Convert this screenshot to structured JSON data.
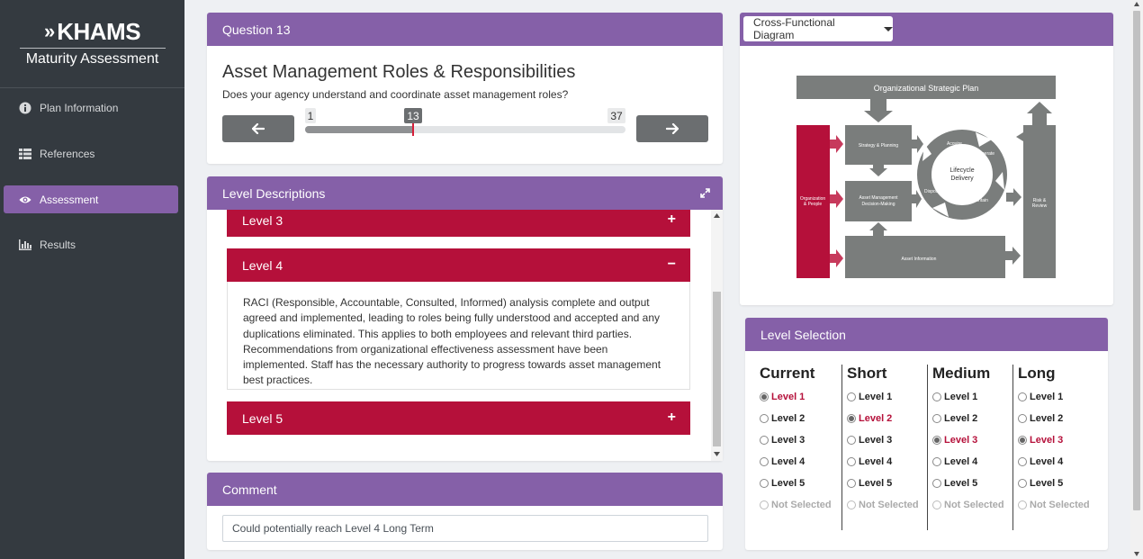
{
  "brand": {
    "logo_main": "KHAMS",
    "logo_sub": "Maturity Assessment"
  },
  "nav": [
    {
      "label": "Plan Information",
      "icon": "info-icon"
    },
    {
      "label": "References",
      "icon": "table-icon"
    },
    {
      "label": "Assessment",
      "icon": "eye-icon"
    },
    {
      "label": "Results",
      "icon": "bar-chart-icon"
    }
  ],
  "question": {
    "header": "Question 13",
    "title": "Asset Management Roles & Responsibilities",
    "subtitle": "Does your agency understand and coordinate asset management roles?",
    "slider": {
      "min": "1",
      "current": "13",
      "max": "37"
    }
  },
  "levels": {
    "header": "Level Descriptions",
    "items": [
      {
        "label": "Level 3",
        "state": "+"
      },
      {
        "label": "Level 4",
        "state": "−",
        "body": "RACI (Responsible, Accountable, Consulted, Informed) analysis complete and output agreed and implemented, leading to roles being fully understood and accepted and any duplications eliminated. This applies to both employees and relevant third parties. Recommendations from organizational effectiveness assessment have been implemented. Staff has the necessary authority to progress towards asset management best practices."
      },
      {
        "label": "Level 5",
        "state": "+"
      }
    ]
  },
  "comment": {
    "header": "Comment",
    "value": "Could potentially reach Level 4 Long Term"
  },
  "diagram": {
    "dropdown_label": "Cross-Functional Diagram",
    "labels": {
      "strategic": "Organizational Strategic Plan",
      "org_people_1": "Organization",
      "org_people_2": "& People",
      "strategy": "Strategy & Planning",
      "amdm_1": "Asset Management",
      "amdm_2": "Decision-Making",
      "asset_info": "Asset Information",
      "lifecycle_1": "Lifecycle",
      "lifecycle_2": "Delivery",
      "acquire": "Acquire",
      "operate": "Operate",
      "maintain": "Maintain",
      "dispose": "Dispose",
      "risk_1": "Risk &",
      "risk_2": "Review"
    }
  },
  "selection": {
    "header": "Level Selection",
    "options": [
      "Level 1",
      "Level 2",
      "Level 3",
      "Level 4",
      "Level 5",
      "Not Selected"
    ],
    "columns": [
      {
        "name": "Current",
        "selected": 0
      },
      {
        "name": "Short",
        "selected": 1
      },
      {
        "name": "Medium",
        "selected": 2
      },
      {
        "name": "Long",
        "selected": 2
      }
    ]
  },
  "colors": {
    "primary": "#8560a8",
    "accent": "#b5103a",
    "sidebar": "#343a40",
    "diagram_gray": "#7a7d7c"
  }
}
